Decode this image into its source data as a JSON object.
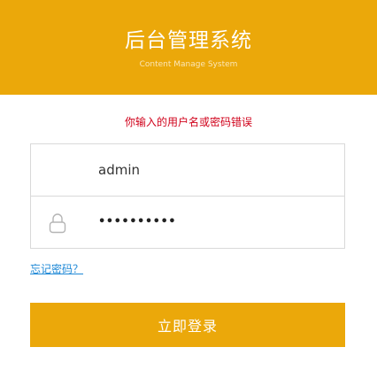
{
  "header": {
    "title": "后台管理系统",
    "subtitle": "Content Manage System",
    "background_color": "#eba80a"
  },
  "error_message": "你输入的用户名或密码错误",
  "form": {
    "username_value": "admin",
    "password_masked": "••••••••••",
    "password_icon": "lock-icon"
  },
  "forgot_link": "忘记密码？",
  "login_button": "立即登录"
}
